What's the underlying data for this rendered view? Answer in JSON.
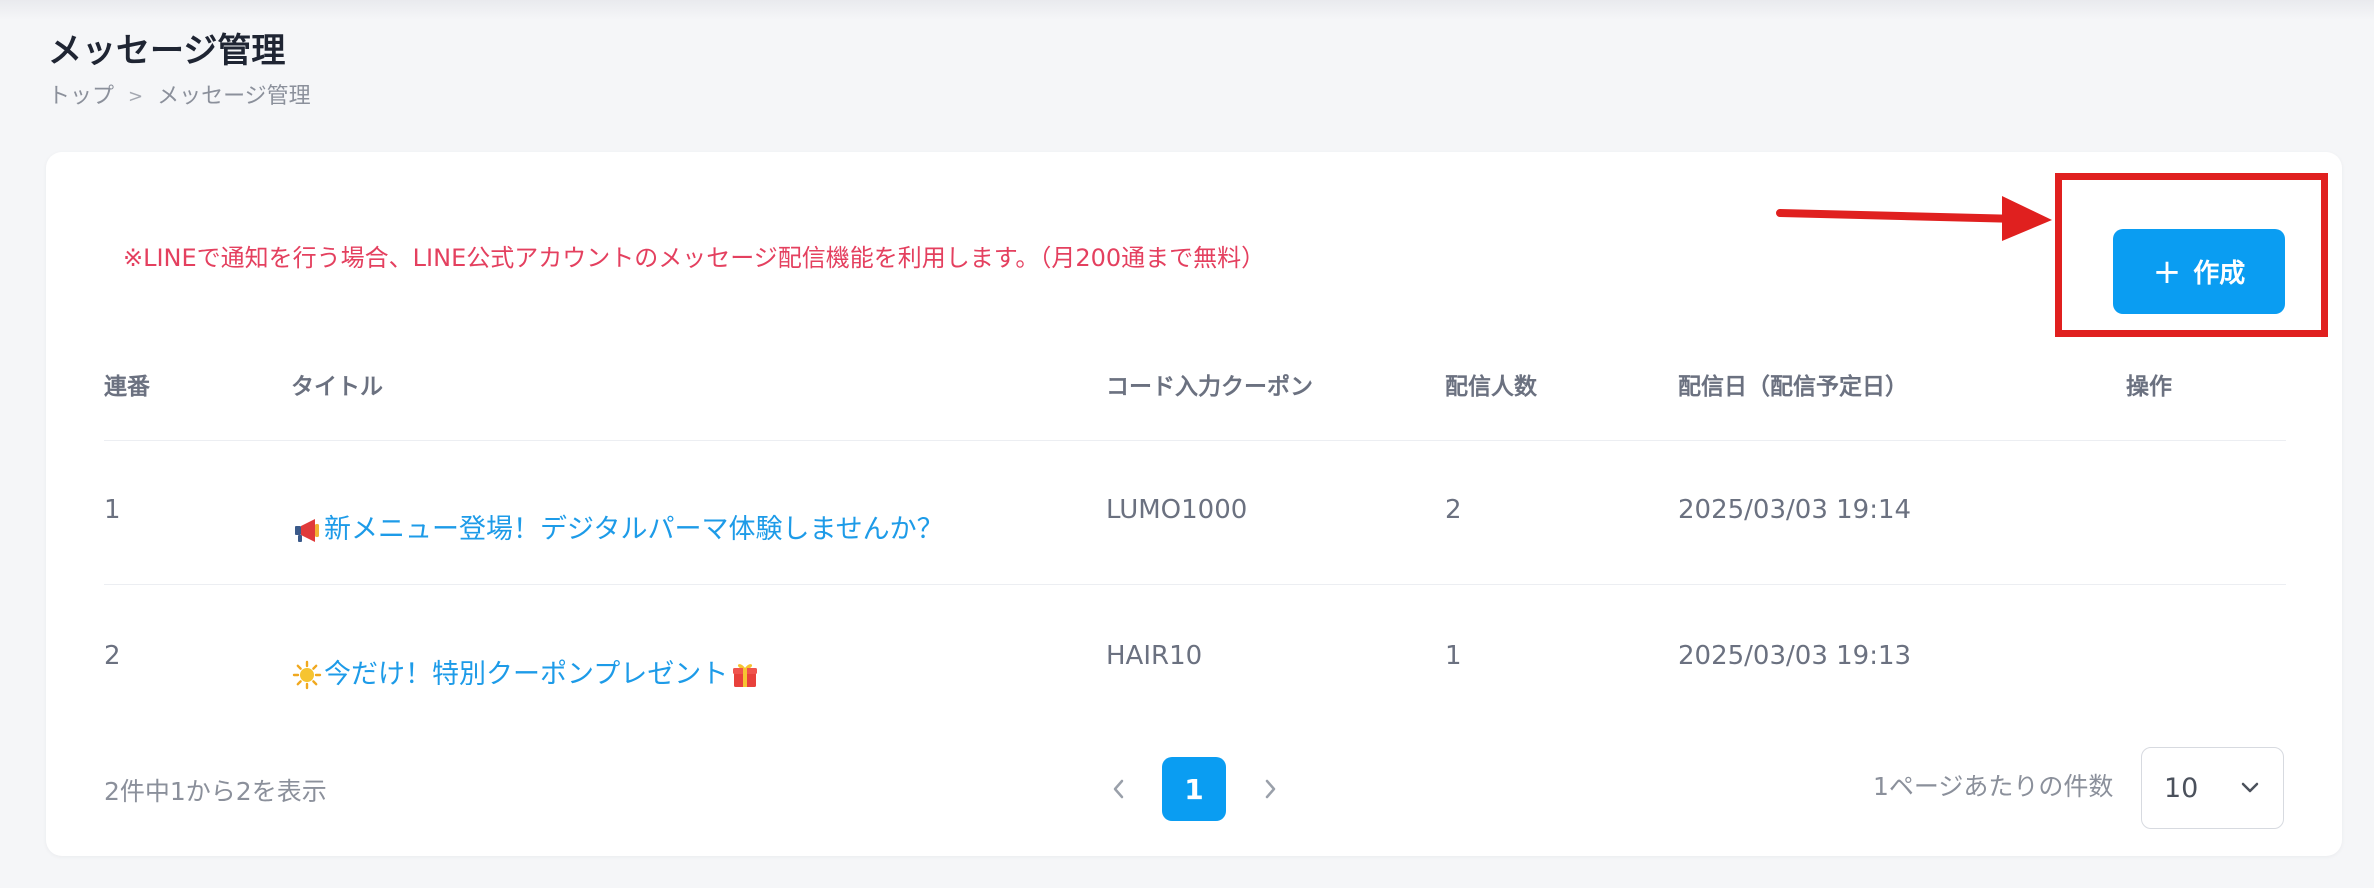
{
  "header": {
    "title": "メッセージ管理",
    "breadcrumb": {
      "home": "トップ",
      "separator": ">",
      "current": "メッセージ管理"
    }
  },
  "notice": "※LINEで通知を行う場合、LINE公式アカウントのメッセージ配信機能を利用します。（月200通まで無料）",
  "create_button": {
    "icon": "plus-icon",
    "label": "作成"
  },
  "table": {
    "columns": [
      "連番",
      "タイトル",
      "コード入力クーポン",
      "配信人数",
      "配信日（配信予定日）",
      "操作"
    ],
    "rows": [
      {
        "no": "1",
        "emoji": "megaphone-icon",
        "title": "新メニュー登場！デジタルパーマ体験しませんか？",
        "title_suffix_emoji": "",
        "coupon": "LUMO1000",
        "recipients": "2",
        "date": "2025/03/03 19:14"
      },
      {
        "no": "2",
        "emoji": "sun-icon",
        "title": "今だけ！特別クーポンプレゼント",
        "title_suffix_emoji": "gift-icon",
        "coupon": "HAIR10",
        "recipients": "1",
        "date": "2025/03/03 19:13"
      }
    ]
  },
  "footer": {
    "summary": "2件中1から2を表示",
    "current_page": "1",
    "per_page_label": "1ページあたりの件数",
    "per_page_value": "10"
  },
  "colors": {
    "accent": "#0a9df2",
    "notice": "#e4405f",
    "annotation": "#e0201f",
    "link": "#1d9be8"
  }
}
